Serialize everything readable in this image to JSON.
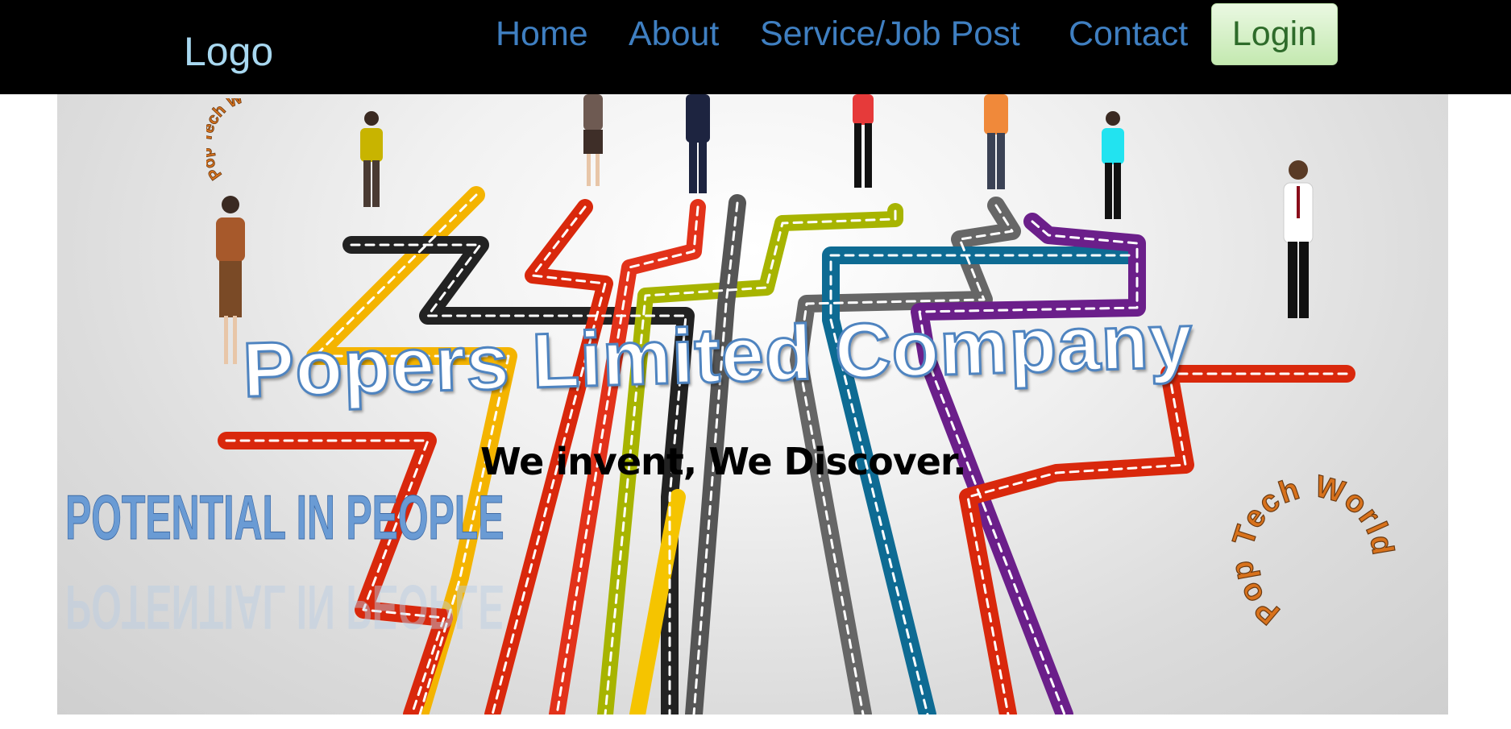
{
  "nav": {
    "logo": "Logo",
    "links": [
      "Home",
      "About",
      "Service/Job Post",
      "Contact"
    ],
    "login": "Login"
  },
  "hero": {
    "title": "Popers Limited Company",
    "tagline": "We invent, We Discover.",
    "potential": "POTENTIAL IN PEOPLE",
    "badge_text": "Pop Tech World",
    "badge_text_small": "Pop Tech W"
  },
  "colors": {
    "nav_bg": "#000000",
    "nav_link": "#3f7fc1",
    "logo": "#a8d8f0",
    "login_bg": "#c4e9b0",
    "title_outline": "#4f84c0",
    "badge": "#d8721c"
  }
}
